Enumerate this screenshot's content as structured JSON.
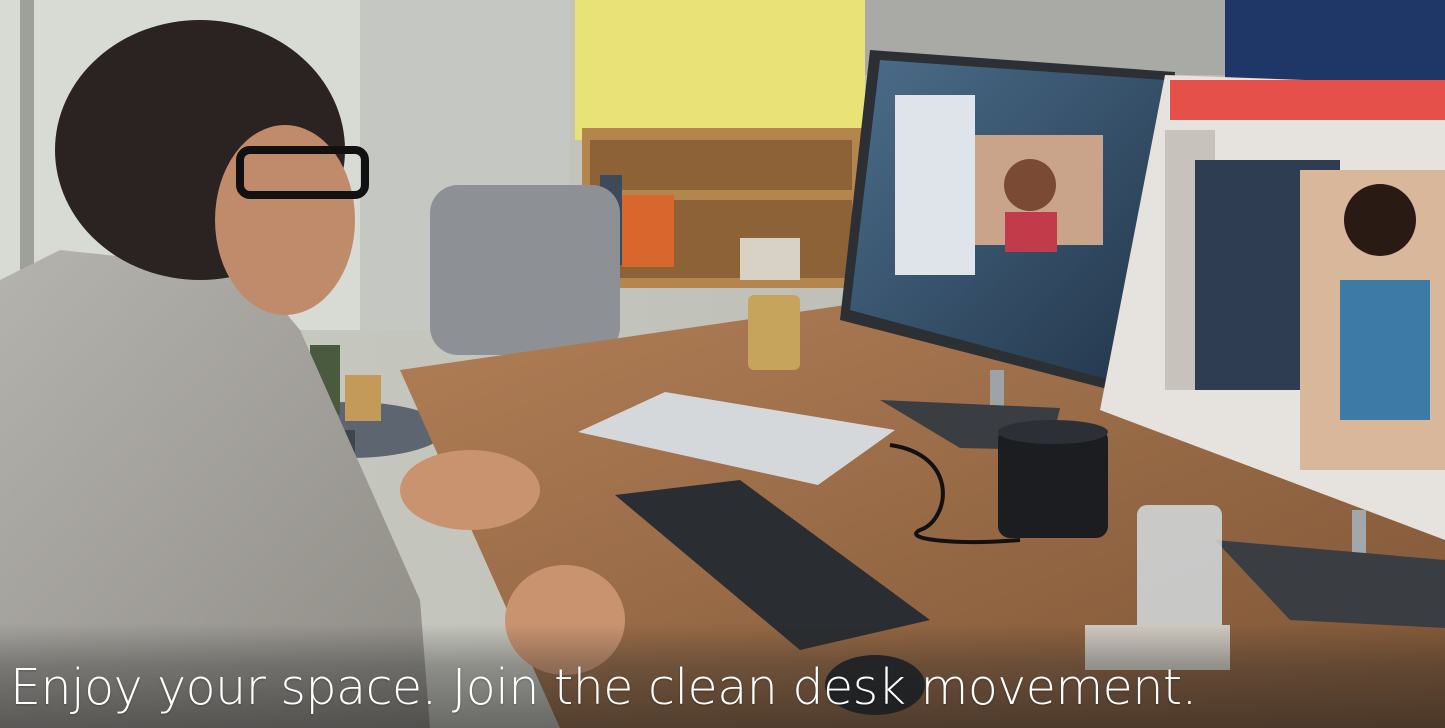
{
  "hero": {
    "headline": "Enjoy your space. Join the clean desk movement.",
    "image_subject": "man-at-desk-video-call-photo",
    "colors": {
      "wall_yellow": "#e9e377",
      "desk_wood": "#9a6a45",
      "screen_blue": "#3c5a78",
      "slide_red": "#e6504a",
      "text_white": "#ffffff"
    }
  }
}
